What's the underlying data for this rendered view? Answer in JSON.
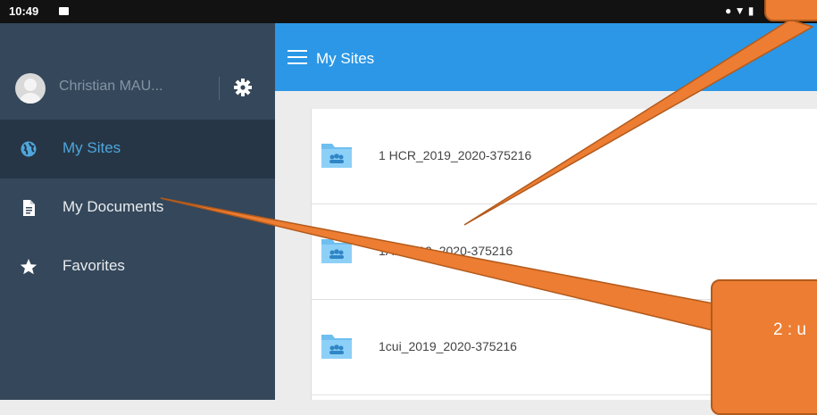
{
  "status_bar": {
    "time": "10:49",
    "right_text": "● ▼ ▮"
  },
  "sidebar": {
    "profile": {
      "name": "Christian MAU..."
    },
    "items": [
      {
        "label": "My Sites",
        "icon": "globe-icon",
        "active": true
      },
      {
        "label": "My Documents",
        "icon": "document-icon",
        "active": false
      },
      {
        "label": "Favorites",
        "icon": "star-icon",
        "active": false
      }
    ]
  },
  "topbar": {
    "title": "My Sites"
  },
  "sites": [
    {
      "name": "1 HCR_2019_2020-375216"
    },
    {
      "name": "1A...2019_2020-375216"
    },
    {
      "name": "1cui_2019_2020-375216"
    }
  ],
  "callouts": {
    "bottom_text": "2 : u"
  },
  "colors": {
    "accent": "#2b97e6",
    "sidebar_bg": "#35475a",
    "active_item_bg": "#263646",
    "callout": "#ec7d32"
  }
}
